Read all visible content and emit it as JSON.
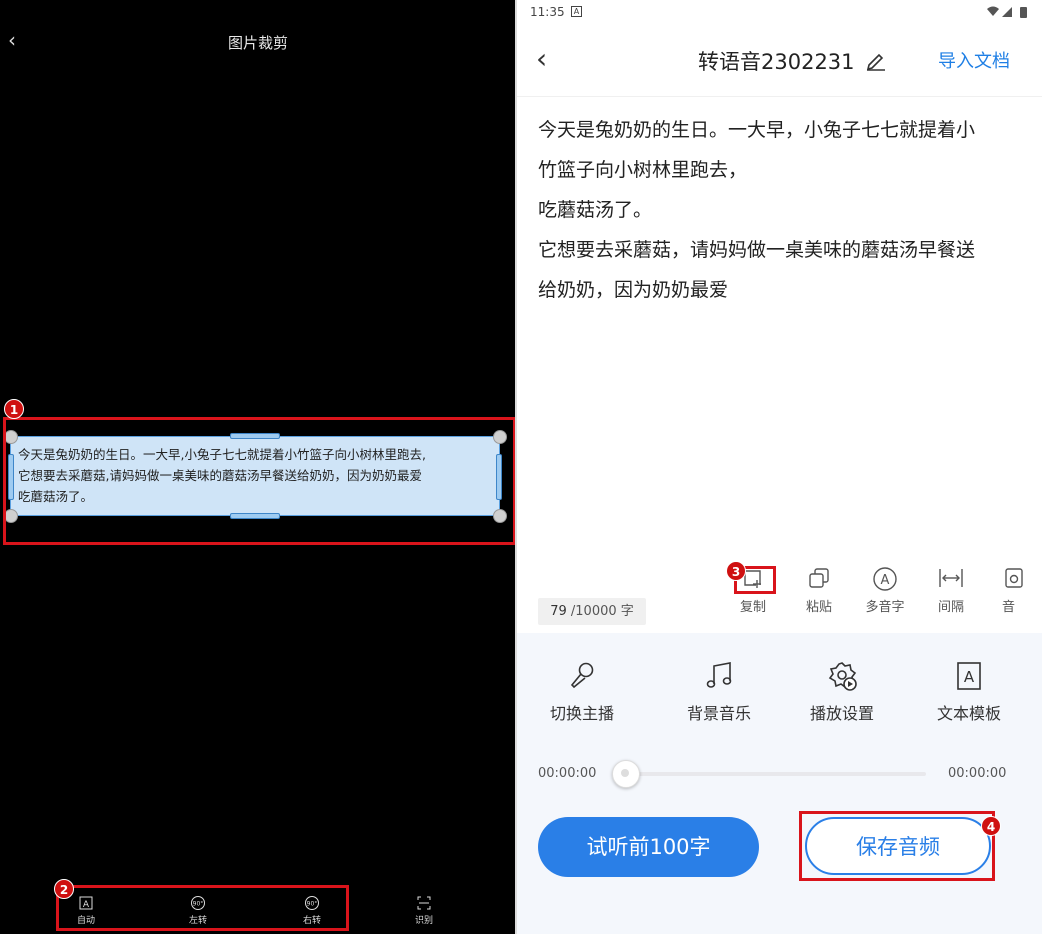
{
  "left": {
    "title": "图片裁剪",
    "crop_text": [
      "今天是兔奶奶的生日。一大早,小兔子七七就提着小竹篮子向小树林里跑去,",
      "它想要去采蘑菇,请妈妈做一桌美味的蘑菇汤早餐送给奶奶，因为奶奶最爱",
      "吃蘑菇汤了。"
    ],
    "tools": [
      {
        "label": "自动",
        "icon": "auto-detect-icon"
      },
      {
        "label": "左转",
        "icon": "rotate-left-icon",
        "glyph": "90°"
      },
      {
        "label": "右转",
        "icon": "rotate-right-icon",
        "glyph": "90°"
      },
      {
        "label": "识别",
        "icon": "recognize-icon"
      }
    ]
  },
  "badges": [
    "1",
    "2",
    "3",
    "4"
  ],
  "status_bar": {
    "time": "11:35",
    "notif": "A"
  },
  "header": {
    "title": "转语音2302231",
    "import_label": "导入文档"
  },
  "editor": {
    "lines": [
      "今天是兔奶奶的生日。一大早，小兔子七七就提着小",
      "竹篮子向小树林里跑去，",
      "吃蘑菇汤了。",
      "它想要去采蘑菇，请妈妈做一桌美味的蘑菇汤早餐送",
      "给奶奶，因为奶奶最爱"
    ],
    "count": "79",
    "count_suffix": "/10000 字"
  },
  "edit_tools": [
    {
      "label": "复制",
      "icon": "copy-icon"
    },
    {
      "label": "粘贴",
      "icon": "paste-icon"
    },
    {
      "label": "多音字",
      "icon": "polyphone-icon",
      "glyph": "A"
    },
    {
      "label": "间隔",
      "icon": "interval-icon"
    },
    {
      "label": "音",
      "icon": "sound-icon"
    }
  ],
  "function_tools": [
    {
      "label": "切换主播",
      "icon": "microphone-icon"
    },
    {
      "label": "背景音乐",
      "icon": "music-note-icon"
    },
    {
      "label": "播放设置",
      "icon": "gear-play-icon"
    },
    {
      "label": "文本模板",
      "icon": "text-template-icon",
      "glyph": "A"
    }
  ],
  "player": {
    "start": "00:00:00",
    "end": "00:00:00",
    "progress": 0
  },
  "buttons": {
    "preview": "试听前100字",
    "save": "保存音频"
  },
  "colors": {
    "accent": "#2a7fe7",
    "annotation": "#d9141b",
    "crop_fill": "#cfe4f7"
  }
}
